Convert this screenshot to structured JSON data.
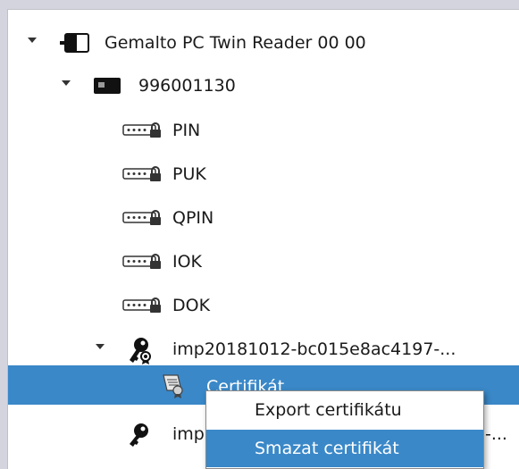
{
  "tree": {
    "reader": {
      "label": "Gemalto PC Twin Reader 00 00",
      "icon": "card-reader-icon",
      "expanded": true
    },
    "card": {
      "label": "996001130",
      "icon": "smart-card-icon",
      "expanded": true
    },
    "pins": [
      {
        "label": "PIN",
        "icon": "pin-key-icon"
      },
      {
        "label": "PUK",
        "icon": "pin-key-icon"
      },
      {
        "label": "QPIN",
        "icon": "pin-key-icon"
      },
      {
        "label": "IOK",
        "icon": "pin-key-icon"
      },
      {
        "label": "DOK",
        "icon": "pin-key-icon"
      }
    ],
    "keypair1": {
      "label": "imp20181012-bc015e8ac4197-...",
      "icon": "key-certificate-icon",
      "expanded": true
    },
    "certificate": {
      "label": "Certifikát",
      "icon": "certificate-icon",
      "selected": true
    },
    "keypair2": {
      "label": "imp",
      "suffix": "-...",
      "icon": "key-icon"
    }
  },
  "context_menu": {
    "items": [
      {
        "label": "Export certifikátu"
      },
      {
        "label": "Smazat certifikát",
        "highlighted": true
      }
    ]
  },
  "colors": {
    "selection": "#3a88c8",
    "background": "#d4d4de"
  }
}
